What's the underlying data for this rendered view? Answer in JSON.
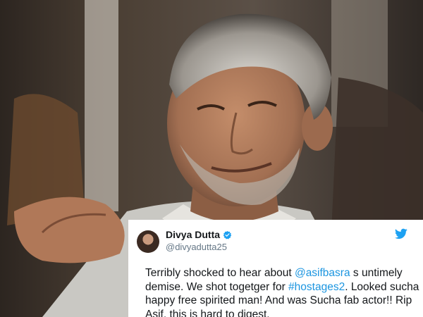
{
  "tweet": {
    "display_name": "Divya Dutta",
    "handle": "@divyadutta25",
    "text_parts": [
      {
        "text": "Terribly shocked to hear about ",
        "link": false
      },
      {
        "text": "@asifbasra",
        "link": true
      },
      {
        "text": " s untimely demise. We shot togetger for ",
        "link": false
      },
      {
        "text": "#hostages2",
        "link": true
      },
      {
        "text": ". Looked sucha happy free spirited man! And was Sucha fab actor!! Rip Asif, this is hard to digest.",
        "link": false
      }
    ],
    "verified_icon": "verified-badge-icon",
    "brand_icon": "twitter-bird-icon"
  },
  "colors": {
    "link": "#1b95e0",
    "verified": "#1da1f2",
    "twitter": "#1da1f2"
  }
}
